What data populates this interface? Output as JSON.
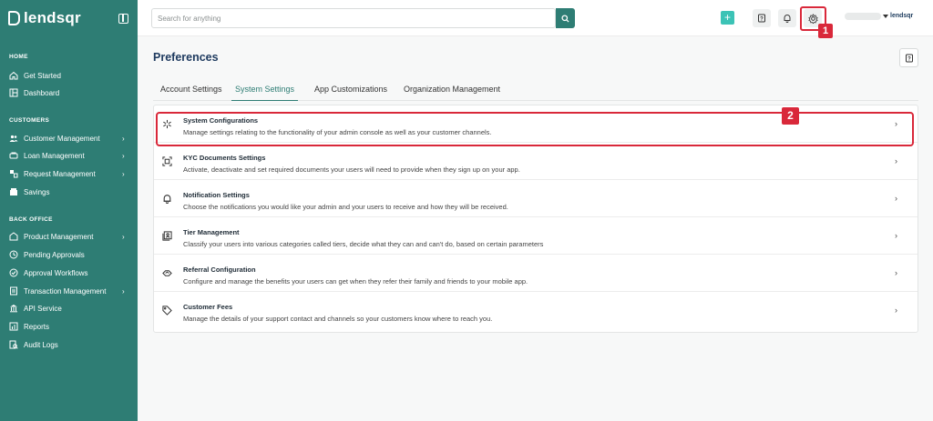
{
  "brand": {
    "name": "lendsqr",
    "small_name": "lendsqr"
  },
  "sidebar": {
    "sections": [
      {
        "title": "HOME",
        "items": [
          {
            "label": "Get Started",
            "icon": "home-icon",
            "has_chevron": false
          },
          {
            "label": "Dashboard",
            "icon": "dashboard-icon",
            "has_chevron": false
          }
        ]
      },
      {
        "title": "CUSTOMERS",
        "items": [
          {
            "label": "Customer Management",
            "icon": "users-icon",
            "has_chevron": true
          },
          {
            "label": "Loan Management",
            "icon": "loan-icon",
            "has_chevron": true
          },
          {
            "label": "Request Management",
            "icon": "request-icon",
            "has_chevron": true
          },
          {
            "label": "Savings",
            "icon": "savings-icon",
            "has_chevron": false
          }
        ]
      },
      {
        "title": "BACK OFFICE",
        "items": [
          {
            "label": "Product Management",
            "icon": "product-icon",
            "has_chevron": true
          },
          {
            "label": "Pending Approvals",
            "icon": "clock-icon",
            "has_chevron": false
          },
          {
            "label": "Approval Workflows",
            "icon": "workflow-icon",
            "has_chevron": false
          },
          {
            "label": "Transaction Management",
            "icon": "transaction-icon",
            "has_chevron": true
          },
          {
            "label": "API Service",
            "icon": "bank-icon",
            "has_chevron": false
          },
          {
            "label": "Reports",
            "icon": "reports-icon",
            "has_chevron": false
          },
          {
            "label": "Audit Logs",
            "icon": "audit-icon",
            "has_chevron": false
          }
        ]
      }
    ]
  },
  "topbar": {
    "search_placeholder": "Search for anything",
    "plus_label": "+",
    "badge_1": "1"
  },
  "page": {
    "title": "Preferences",
    "tabs": [
      {
        "label": "Account Settings",
        "active": false
      },
      {
        "label": "System Settings",
        "active": true
      },
      {
        "label": "App Customizations",
        "active": false
      },
      {
        "label": "Organization Management",
        "active": false
      }
    ],
    "badge_2": "2",
    "settings": [
      {
        "title": "System Configurations",
        "desc": "Manage settings relating to the functionality of your admin console as well as your customer channels.",
        "icon": "asterisk-icon"
      },
      {
        "title": "KYC Documents Settings",
        "desc": "Activate, deactivate and set required documents your users will need to provide when they sign up on your app.",
        "icon": "scan-icon"
      },
      {
        "title": "Notification Settings",
        "desc": "Choose the notifications you would like your admin and your users to receive and how they will be received.",
        "icon": "bell-icon"
      },
      {
        "title": "Tier Management",
        "desc": "Classify your users into various categories called tiers, decide what they can and can't do, based on certain parameters",
        "icon": "tier-icon"
      },
      {
        "title": "Referral Configuration",
        "desc": "Configure and manage the benefits your users can get when they refer their family and friends to your mobile app.",
        "icon": "referral-icon"
      },
      {
        "title": "Customer Fees",
        "desc": "Manage the details of your support contact and channels so your customers know where to reach you.",
        "icon": "tag-icon"
      }
    ]
  },
  "colors": {
    "sidebar": "#2e7d74",
    "accent": "#3cc3b6",
    "highlight": "#d9283a",
    "title": "#1e3a5f"
  }
}
